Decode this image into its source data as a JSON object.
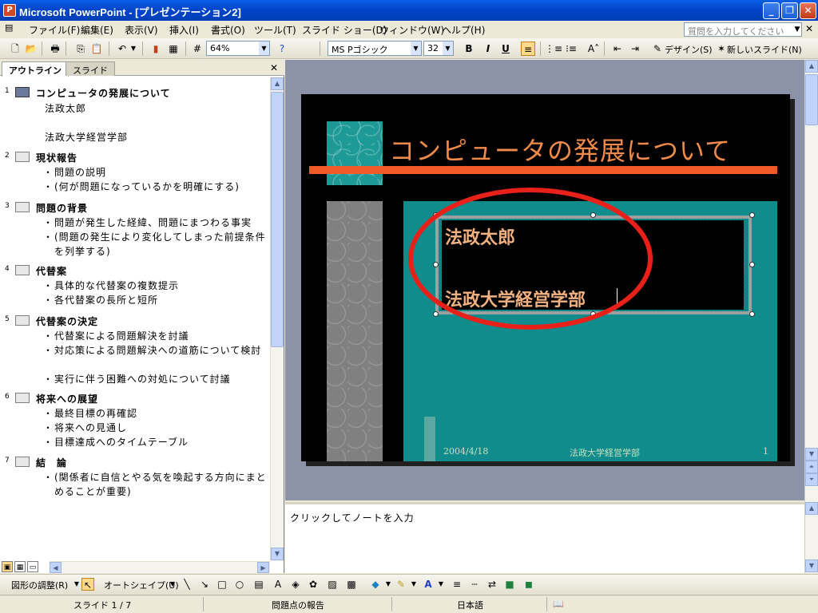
{
  "window": {
    "title": "Microsoft PowerPoint - [プレゼンテーション2]",
    "app_icon": "powerpoint-icon",
    "controls": [
      "minimize-icon",
      "restore-icon",
      "close-icon"
    ]
  },
  "menu": {
    "items": [
      "ファイル(F)",
      "編集(E)",
      "表示(V)",
      "挿入(I)",
      "書式(O)",
      "ツール(T)",
      "スライド ショー(D)",
      "ウィンドウ(W)",
      "ヘルプ(H)"
    ],
    "help_placeholder": "質問を入力してください"
  },
  "toolbar": {
    "zoom": "64%",
    "font_name": "MS Pゴシック",
    "font_size": "32",
    "bold": "B",
    "italic": "I",
    "underline": "U",
    "design_label": "デザイン(S)",
    "new_slide_label": "新しいスライド(N)"
  },
  "left_panel": {
    "tabs": [
      "アウトライン",
      "スライド"
    ],
    "active_tab": "アウトライン",
    "outline": [
      {
        "num": "1",
        "title": "コンピュータの発展について",
        "lines": [
          "法政太郎",
          "",
          "法政大学経営学部"
        ],
        "bullets": []
      },
      {
        "num": "2",
        "title": "現状報告",
        "lines": [],
        "bullets": [
          "問題の説明",
          "(何が問題になっているかを明確にする)"
        ]
      },
      {
        "num": "3",
        "title": "問題の背景",
        "lines": [],
        "bullets": [
          "問題が発生した経緯、問題にまつわる事実",
          "(問題の発生により変化してしまった前提条件を列挙する)"
        ]
      },
      {
        "num": "4",
        "title": "代替案",
        "lines": [],
        "bullets": [
          "具体的な代替案の複数提示",
          "各代替案の長所と短所"
        ]
      },
      {
        "num": "5",
        "title": "代替案の決定",
        "lines": [],
        "bullets": [
          "代替案による問題解決を討議",
          "対応策による問題解決への道筋について検討",
          "実行に伴う困難への対処について討議"
        ]
      },
      {
        "num": "6",
        "title": "将来への展望",
        "lines": [],
        "bullets": [
          "最終目標の再確認",
          "将来への見通し",
          "目標達成へのタイムテーブル"
        ]
      },
      {
        "num": "7",
        "title": "結　論",
        "lines": [],
        "bullets": [
          "(関係者に自信とやる気を喚起する方向にまとめることが重要)"
        ]
      }
    ]
  },
  "slide": {
    "title": "コンピュータの発展について",
    "subtitle_line1": "法政太郎",
    "subtitle_line2": "法政大学経営学部",
    "footer_date": "2004/4/18",
    "footer_text": "法政大学経営学部",
    "footer_page": "1",
    "colors": {
      "background": "#000000",
      "accent_bar": "#F05A28",
      "title": "#F08A4A",
      "panel": "#108C8C",
      "subtitle": "#F0B080"
    }
  },
  "notes": {
    "placeholder": "クリックしてノートを入力"
  },
  "draw_toolbar": {
    "draw_label": "図形の調整(R)",
    "autoshape_label": "オートシェイプ(U)"
  },
  "status": {
    "slide_info": "スライド 1 / 7",
    "design": "問題点の報告",
    "language": "日本語"
  }
}
